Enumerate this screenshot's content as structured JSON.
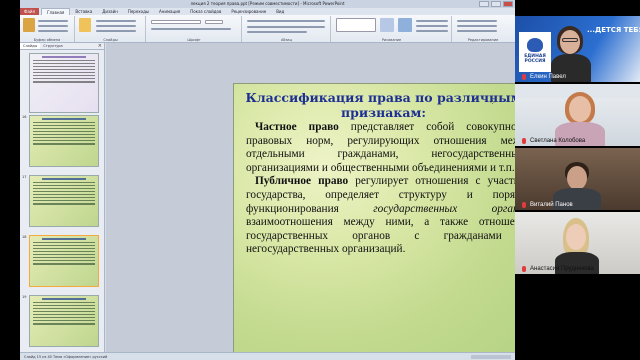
{
  "window": {
    "title": "лекция 2 теория права.ppt [Режим совместимости] - Microsoft PowerPoint"
  },
  "ribbon": {
    "file_tab": "Файл",
    "tabs": [
      "Главная",
      "Вставка",
      "Дизайн",
      "Переходы",
      "Анимация",
      "Показ слайдов",
      "Рецензирование",
      "Вид"
    ],
    "groups": [
      "Буфер обмена",
      "Слайды",
      "Шрифт",
      "Абзац",
      "Рисование",
      "Редактирование"
    ]
  },
  "left_panel": {
    "tabs": [
      "Слайды",
      "Структура"
    ],
    "close": "×",
    "slide_numbers": [
      "",
      "16",
      "17",
      "18",
      "19"
    ]
  },
  "slide": {
    "heading": "Классификация права по различным признакам:",
    "para1_term": "Частное право",
    "para1_text": " представляет собой совокупность правовых норм, регулирующих отношения между отдельными гражданами, негосударственными организациями и общественными объединениями и т.п.;",
    "para2_term": "Публичное право",
    "para2_text_a": " регулирует отношения с участием государства, определяет структуру и порядок функционирования ",
    "para2_italic": "государственных органов",
    "para2_text_b": ", взаимоотношения между ними, а также отношения государственных органов с гражданами и негосударственных организаций."
  },
  "status_bar": {
    "text": "Слайд 15 из 40   Тема «Оформление»   русский"
  },
  "participants": [
    {
      "name": "Елкин Павел",
      "mic": "muted"
    },
    {
      "name": "Светлана Колобова",
      "mic": "muted"
    },
    {
      "name": "Виталий Панов",
      "mic": "muted"
    },
    {
      "name": "Анастасия Прудникова",
      "mic": "muted"
    }
  ],
  "banner": {
    "party": "ЕДИНАЯ РОССИЯ",
    "slogan": "...ДЕТСЯ ТЕБЯ!"
  },
  "colors": {
    "heading": "#1e2f93",
    "file_tab": "#c0504d",
    "mic_muted": "#e23b3b",
    "selected_thumb": "#f3a93b"
  }
}
